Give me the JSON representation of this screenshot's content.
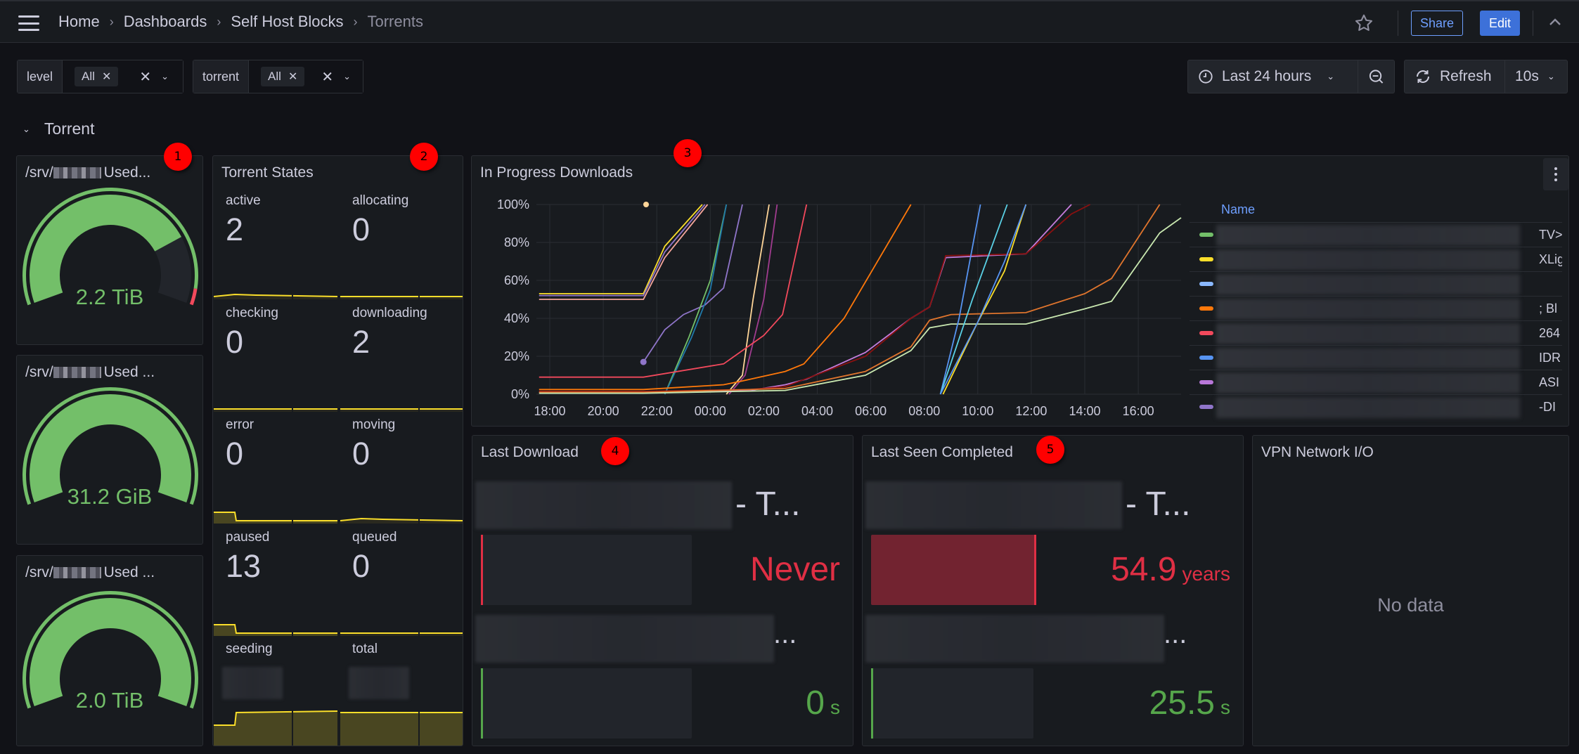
{
  "header": {
    "breadcrumb": [
      "Home",
      "Dashboards",
      "Self Host Blocks",
      "Torrents"
    ],
    "share_label": "Share",
    "edit_label": "Edit",
    "accent": "#3d71d9"
  },
  "variables": [
    {
      "label": "level",
      "value": "All"
    },
    {
      "label": "torrent",
      "value": "All"
    }
  ],
  "time": {
    "range_label": "Last 24 hours",
    "refresh_label": "Refresh",
    "interval": "10s"
  },
  "row": {
    "title": "Torrent"
  },
  "badges": [
    "1",
    "2",
    "3",
    "4",
    "5"
  ],
  "gauges": [
    {
      "title_prefix": "/srv/",
      "title_suffix": "Used...",
      "value": "2.2 TiB",
      "fill": 0.78,
      "threshold_red_from": 0.95
    },
    {
      "title_prefix": "/srv/",
      "title_suffix": "Used ...",
      "value": "31.2 GiB",
      "fill": 1.0
    },
    {
      "title_prefix": "/srv/",
      "title_suffix": "Used ...",
      "value": "2.0 TiB",
      "fill": 1.0
    }
  ],
  "torrent_states": {
    "title": "Torrent States",
    "stats": [
      {
        "name": "active",
        "value": "2"
      },
      {
        "name": "allocating",
        "value": "0"
      },
      {
        "name": "checking",
        "value": "0"
      },
      {
        "name": "downloading",
        "value": "2"
      },
      {
        "name": "error",
        "value": "0"
      },
      {
        "name": "moving",
        "value": "0"
      },
      {
        "name": "paused",
        "value": "13"
      },
      {
        "name": "queued",
        "value": "0"
      },
      {
        "name": "seeding",
        "value": ""
      },
      {
        "name": "total",
        "value": ""
      }
    ]
  },
  "chart_data": {
    "type": "line",
    "title": "In Progress Downloads",
    "xlabel": "",
    "ylabel": "",
    "x_ticks": [
      "18:00",
      "20:00",
      "22:00",
      "00:00",
      "02:00",
      "04:00",
      "06:00",
      "08:00",
      "10:00",
      "12:00",
      "14:00",
      "16:00"
    ],
    "y_ticks": [
      "0%",
      "20%",
      "40%",
      "60%",
      "80%",
      "100%"
    ],
    "x_range_hours": [
      17.5,
      41.6
    ],
    "ylim": [
      0,
      100
    ],
    "grid": true,
    "legend": {
      "placement": "right",
      "header": "Name"
    },
    "series": [
      {
        "color": "#fade2a",
        "points": [
          [
            17.6,
            53
          ],
          [
            21.5,
            53
          ],
          [
            22.3,
            78
          ],
          [
            23.7,
            100
          ]
        ]
      },
      {
        "color": "#8f75c9",
        "points": [
          [
            17.6,
            52
          ],
          [
            21.5,
            52
          ],
          [
            22.3,
            75
          ],
          [
            23.8,
            100
          ]
        ]
      },
      {
        "color": "#f4a59b",
        "points": [
          [
            17.6,
            50
          ],
          [
            21.5,
            50
          ],
          [
            22.3,
            72
          ],
          [
            23.9,
            100
          ]
        ]
      },
      {
        "color": "#fed598",
        "points": [
          [
            21.6,
            100
          ]
        ]
      },
      {
        "color": "#8f75c9",
        "points": [
          [
            21.5,
            17
          ],
          [
            22.3,
            34
          ],
          [
            23.0,
            42
          ],
          [
            23.8,
            47
          ],
          [
            24.5,
            56
          ],
          [
            25.2,
            100
          ]
        ]
      },
      {
        "color": "#73bf69",
        "points": [
          [
            22.3,
            0
          ],
          [
            23.2,
            30
          ],
          [
            24.0,
            60
          ],
          [
            24.6,
            100
          ]
        ]
      },
      {
        "color": "#1f78a8",
        "points": [
          [
            22.3,
            0
          ],
          [
            23.3,
            30
          ],
          [
            24.0,
            55
          ],
          [
            24.6,
            100
          ]
        ]
      },
      {
        "color": "#fed598",
        "points": [
          [
            24.6,
            0
          ],
          [
            25.2,
            10
          ],
          [
            25.6,
            50
          ],
          [
            26.2,
            100
          ]
        ]
      },
      {
        "color": "#a03c8f",
        "points": [
          [
            24.7,
            0
          ],
          [
            25.3,
            10
          ],
          [
            26.0,
            50
          ],
          [
            26.5,
            100
          ]
        ]
      },
      {
        "color": "#f2495c",
        "points": [
          [
            17.6,
            9
          ],
          [
            21.5,
            9
          ],
          [
            24.5,
            16
          ],
          [
            26.0,
            31
          ],
          [
            26.7,
            42
          ],
          [
            27.6,
            100
          ]
        ]
      },
      {
        "color": "#ff780a",
        "points": [
          [
            17.6,
            2.5
          ],
          [
            21.5,
            2.5
          ],
          [
            24.5,
            5
          ],
          [
            25.2,
            7
          ],
          [
            26.8,
            12
          ],
          [
            27.5,
            16
          ],
          [
            29.0,
            40
          ],
          [
            31.5,
            100
          ]
        ]
      },
      {
        "color": "#c57cdb",
        "points": [
          [
            17.6,
            1
          ],
          [
            21.5,
            1
          ],
          [
            25.5,
            2
          ],
          [
            26.8,
            5
          ],
          [
            27.6,
            8
          ],
          [
            29.8,
            22
          ],
          [
            31.5,
            40
          ],
          [
            32.2,
            46
          ],
          [
            32.8,
            72
          ],
          [
            35.8,
            74
          ],
          [
            37.5,
            100
          ]
        ]
      },
      {
        "color": "#8a1010",
        "points": [
          [
            17.6,
            1.5
          ],
          [
            21.5,
            1.5
          ],
          [
            25.5,
            2.5
          ],
          [
            26.8,
            4
          ],
          [
            29.8,
            20
          ],
          [
            31.5,
            40
          ],
          [
            32.2,
            46
          ],
          [
            32.8,
            73
          ],
          [
            35.8,
            74
          ],
          [
            37.5,
            95
          ],
          [
            38.2,
            100
          ]
        ]
      },
      {
        "color": "#e0752d",
        "points": [
          [
            17.6,
            1
          ],
          [
            21.5,
            1
          ],
          [
            26.8,
            3
          ],
          [
            29.8,
            12
          ],
          [
            31.5,
            25
          ],
          [
            32.2,
            39
          ],
          [
            33.0,
            42
          ],
          [
            35.8,
            43
          ],
          [
            38.0,
            53
          ],
          [
            39.0,
            61
          ],
          [
            40.8,
            100
          ]
        ]
      },
      {
        "color": "#c9e8b0",
        "points": [
          [
            17.6,
            0.5
          ],
          [
            21.5,
            0.5
          ],
          [
            26.8,
            2
          ],
          [
            29.8,
            10
          ],
          [
            31.5,
            23
          ],
          [
            32.2,
            35
          ],
          [
            33.0,
            37
          ],
          [
            35.8,
            37
          ],
          [
            38.0,
            45
          ],
          [
            39.0,
            49
          ],
          [
            40.8,
            85
          ],
          [
            41.6,
            93
          ]
        ]
      },
      {
        "color": "#5794f2",
        "points": [
          [
            32.6,
            0
          ],
          [
            33.3,
            40
          ],
          [
            34.1,
            100
          ]
        ]
      },
      {
        "color": "#5ad1e6",
        "points": [
          [
            32.6,
            0
          ],
          [
            33.8,
            50
          ],
          [
            35.1,
            100
          ]
        ]
      },
      {
        "color": "#fade2a",
        "points": [
          [
            32.7,
            0
          ],
          [
            34.0,
            38
          ],
          [
            35.0,
            65
          ],
          [
            35.8,
            100
          ]
        ]
      },
      {
        "color": "#5794f2",
        "points": [
          [
            32.6,
            0
          ],
          [
            34.0,
            38
          ],
          [
            35.0,
            70
          ],
          [
            35.8,
            100
          ]
        ]
      }
    ],
    "legend_rows": [
      {
        "color": "#73bf69",
        "name_tail": "TV>"
      },
      {
        "color": "#fade2a",
        "name_tail": "XLig"
      },
      {
        "color": "#8ab8ff",
        "name_tail": ""
      },
      {
        "color": "#ff780a",
        "name_tail": "; Bl"
      },
      {
        "color": "#f2495c",
        "name_tail": "264"
      },
      {
        "color": "#5794f2",
        "name_tail": "IDR"
      },
      {
        "color": "#b877d9",
        "name_tail": "ASI"
      },
      {
        "color": "#8f75c9",
        "name_tail": "-DI"
      }
    ]
  },
  "last_download": {
    "title": "Last Download",
    "rows": [
      {
        "name_tail": "- T...",
        "value": "Never",
        "unit": "",
        "color": "#e02f44",
        "fill": 0.0
      },
      {
        "name_tail": "...",
        "value": "0",
        "unit": "s",
        "color": "#56a64b",
        "fill": 0.0
      }
    ]
  },
  "last_seen_completed": {
    "title": "Last Seen Completed",
    "rows": [
      {
        "name_tail": "- T...",
        "value": "54.9",
        "unit": "years",
        "color": "#e02f44",
        "fill": 1.0
      },
      {
        "name_tail": "...",
        "value": "25.5",
        "unit": "s",
        "color": "#56a64b",
        "fill": 0.0
      }
    ]
  },
  "vpn": {
    "title": "VPN Network I/O",
    "empty_text": "No data"
  }
}
